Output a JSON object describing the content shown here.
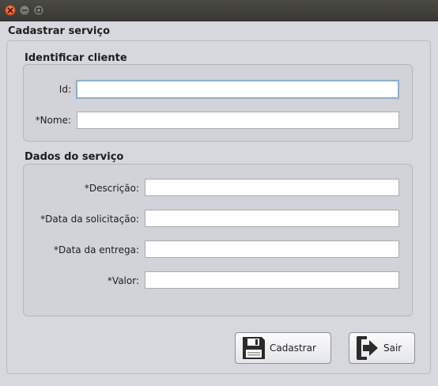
{
  "window": {
    "controls": [
      "close-icon",
      "minimize-icon",
      "maximize-icon"
    ]
  },
  "form": {
    "title": "Cadastrar serviço"
  },
  "client_section": {
    "title": "Identificar cliente",
    "id_label": "Id:",
    "id_value": "",
    "name_label": "*Nome:",
    "name_value": ""
  },
  "service_section": {
    "title": "Dados do serviço",
    "description_label": "*Descrição:",
    "description_value": "",
    "request_date_label": "*Data da solicitação:",
    "request_date_value": "",
    "delivery_date_label": "*Data da entrega:",
    "delivery_date_value": "",
    "value_label": "*Valor:",
    "value_value": ""
  },
  "actions": {
    "register_label": "Cadastrar",
    "register_icon": "floppy-disk-icon",
    "exit_label": "Sair",
    "exit_icon": "exit-icon"
  },
  "colors": {
    "background": "#d6d8de",
    "titlebar": "#3c3b37",
    "close_button": "#e9561f",
    "focus_border": "#8faecd"
  }
}
